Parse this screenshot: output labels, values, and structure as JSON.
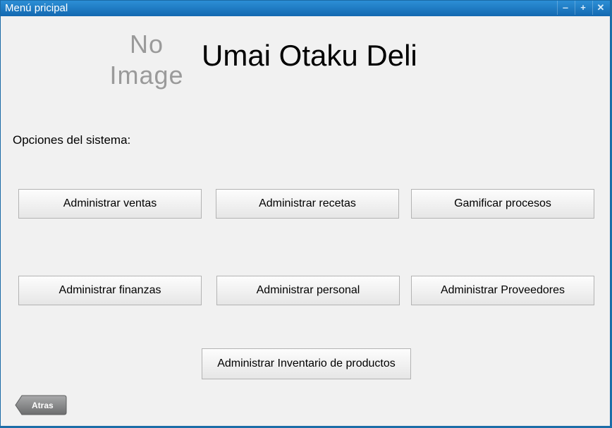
{
  "window": {
    "title": "Menú pricipal",
    "controls": [
      "‒",
      "+",
      "✕"
    ]
  },
  "logo": {
    "line1": "No",
    "line2": "Image"
  },
  "app": {
    "name": "Umai Otaku Deli"
  },
  "section_label": "Opciones del sistema:",
  "buttons": {
    "ventas": "Administrar ventas",
    "recetas": "Administrar recetas",
    "gamificar": "Gamificar procesos",
    "finanzas": "Administrar finanzas",
    "personal": "Administrar personal",
    "proveedores": "Administrar Proveedores",
    "inventario": "Administrar Inventario de productos"
  },
  "back_label": "Atras"
}
